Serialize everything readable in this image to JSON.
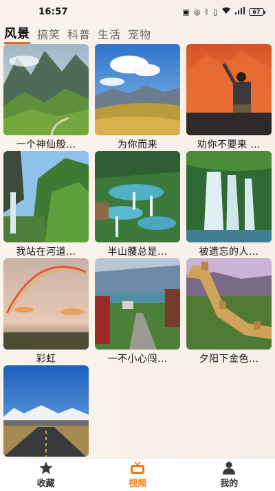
{
  "status": {
    "time": "16:57",
    "battery": "67"
  },
  "tabs": [
    {
      "label": "风景",
      "active": true
    },
    {
      "label": "搞笑",
      "active": false
    },
    {
      "label": "科普",
      "active": false
    },
    {
      "label": "生活",
      "active": false
    },
    {
      "label": "宠物",
      "active": false
    }
  ],
  "videos": [
    {
      "title": "一个神仙般…"
    },
    {
      "title": "为你而来"
    },
    {
      "title": "劝你不要来 …"
    },
    {
      "title": "我站在河道…"
    },
    {
      "title": "半山腰总是…"
    },
    {
      "title": "被遗忘的人…"
    },
    {
      "title": "彩虹"
    },
    {
      "title": "一不小心闯…"
    },
    {
      "title": "夕阳下金色…"
    }
  ],
  "nav": [
    {
      "label": "收藏",
      "icon": "star-icon",
      "active": false
    },
    {
      "label": "视频",
      "icon": "tv-icon",
      "active": true
    },
    {
      "label": "我的",
      "icon": "user-icon",
      "active": false
    }
  ],
  "colors": {
    "accent": "#f07a1a",
    "tab_underline": "#e26b1f"
  }
}
